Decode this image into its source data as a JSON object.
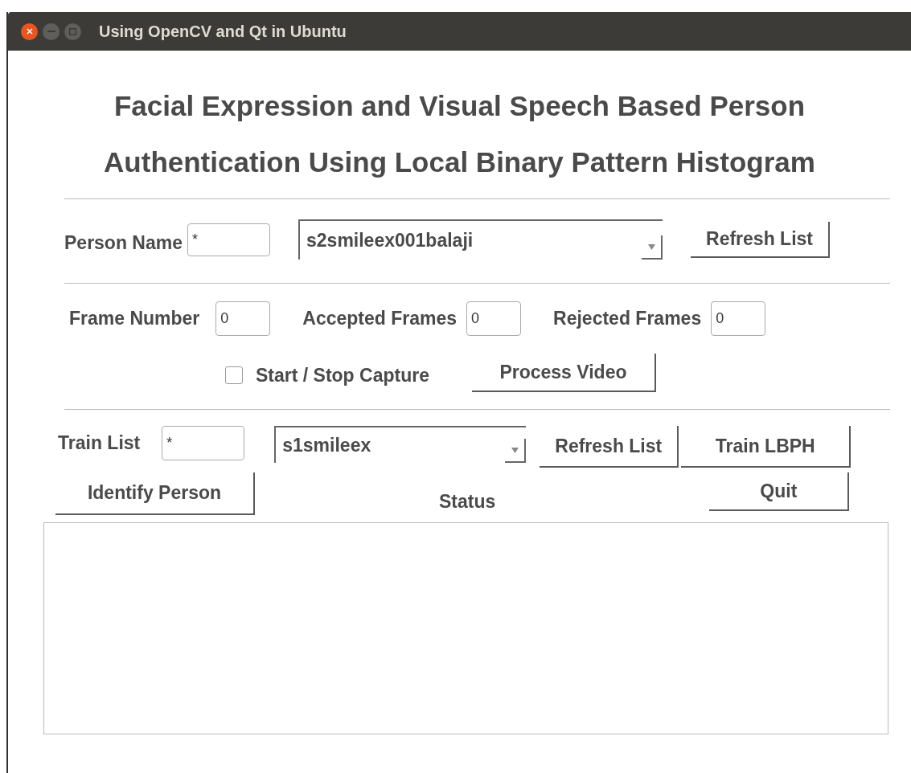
{
  "window": {
    "title": "Using OpenCV and Qt in Ubuntu"
  },
  "heading_lines": [
    "Facial Expression and Visual Speech Based Person",
    "Authentication Using Local Binary Pattern Histogram"
  ],
  "person": {
    "label": "Person Name",
    "value": "*",
    "combo": "s2smileex001balaji",
    "refresh_button": "Refresh List"
  },
  "frames": [
    {
      "label": "Frame Number",
      "value": "0"
    },
    {
      "label": "Accepted Frames",
      "value": "0"
    },
    {
      "label": "Rejected Frames",
      "value": "0"
    }
  ],
  "capture": {
    "label": "Start / Stop Capture",
    "checked": false
  },
  "process_button": "Process Video",
  "train": {
    "label": "Train List",
    "value": "*",
    "combo": "s1smileex",
    "refresh_button": "Refresh List",
    "train_button": "Train LBPH"
  },
  "identify_button": "Identify Person",
  "status_label": "Status",
  "quit_button": "Quit"
}
